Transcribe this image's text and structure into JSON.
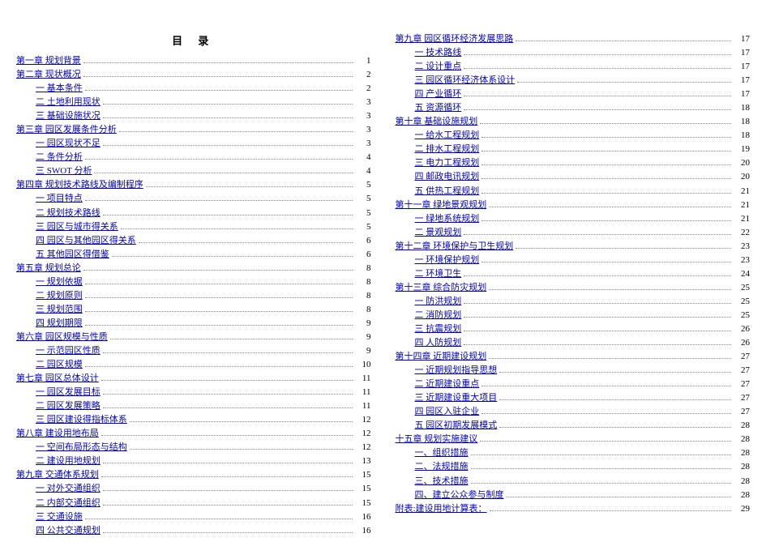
{
  "title": "目  录",
  "columns": [
    [
      {
        "label": "第一章 规划背景",
        "page": "1",
        "level": 0
      },
      {
        "label": "第二章 现状概况",
        "page": "2",
        "level": 0
      },
      {
        "label": "一 基本条件",
        "page": "2",
        "level": 1
      },
      {
        "label": "二 土地利用现状",
        "page": "3",
        "level": 1
      },
      {
        "label": "三 基础设施状况",
        "page": "3",
        "level": 1
      },
      {
        "label": "第三章 园区发展条件分析",
        "page": "3",
        "level": 0
      },
      {
        "label": "一 园区现状不足",
        "page": "3",
        "level": 1
      },
      {
        "label": "二 条件分析",
        "page": "4",
        "level": 1
      },
      {
        "label": "三 SWOT 分析",
        "page": "4",
        "level": 1
      },
      {
        "label": "第四章 规划技术路线及编制程序",
        "page": "5",
        "level": 0
      },
      {
        "label": "一 项目特点",
        "page": "5",
        "level": 1
      },
      {
        "label": "二 规划技术路线",
        "page": "5",
        "level": 1
      },
      {
        "label": "三 园区与城市得关系",
        "page": "5",
        "level": 1
      },
      {
        "label": "四 园区与其他园区得关系",
        "page": "6",
        "level": 1
      },
      {
        "label": "五 其他园区得借鉴",
        "page": "6",
        "level": 1
      },
      {
        "label": "第五章 规划总论",
        "page": "8",
        "level": 0
      },
      {
        "label": "一 规划依据",
        "page": "8",
        "level": 1
      },
      {
        "label": "二 规划原则",
        "page": "8",
        "level": 1
      },
      {
        "label": "三 规划范围",
        "page": "8",
        "level": 1
      },
      {
        "label": "四 规划期限",
        "page": "9",
        "level": 1
      },
      {
        "label": "第六章 园区规模与性质",
        "page": "9",
        "level": 0
      },
      {
        "label": "一 示范园区性质",
        "page": "9",
        "level": 1
      },
      {
        "label": "二 园区规模",
        "page": "10",
        "level": 1
      },
      {
        "label": "第七章 园区总体设计",
        "page": "11",
        "level": 0
      },
      {
        "label": "一 园区发展目标",
        "page": "11",
        "level": 1
      },
      {
        "label": "二 园区发展策略",
        "page": "11",
        "level": 1
      },
      {
        "label": "三 园区建设得指标体系",
        "page": "12",
        "level": 1
      },
      {
        "label": "第八章 建设用地布局",
        "page": "12",
        "level": 0
      },
      {
        "label": "一 空间布局形态与结构",
        "page": "12",
        "level": 1
      },
      {
        "label": "二 建设用地规划",
        "page": "13",
        "level": 1
      },
      {
        "label": "第九章 交通体系规划",
        "page": "15",
        "level": 0
      },
      {
        "label": "一 对外交通组织",
        "page": "15",
        "level": 1
      },
      {
        "label": "二 内部交通组织",
        "page": "15",
        "level": 1
      },
      {
        "label": "三 交通设施",
        "page": "16",
        "level": 1
      },
      {
        "label": "四 公共交通规划",
        "page": "16",
        "level": 1
      }
    ],
    [
      {
        "label": "第九章  园区循环经济发展思路",
        "page": "17",
        "level": 0
      },
      {
        "label": "一 技术路线",
        "page": "17",
        "level": 1
      },
      {
        "label": "二 设计重点",
        "page": "17",
        "level": 1
      },
      {
        "label": "三 园区循环经济体系设计",
        "page": "17",
        "level": 1
      },
      {
        "label": "四 产业循环",
        "page": "17",
        "level": 1
      },
      {
        "label": "五 资源循环",
        "page": "18",
        "level": 1
      },
      {
        "label": "第十章 基础设施规划",
        "page": "18",
        "level": 0
      },
      {
        "label": "一 给水工程规划",
        "page": "18",
        "level": 1
      },
      {
        "label": "二 排水工程规划",
        "page": "19",
        "level": 1
      },
      {
        "label": "三 电力工程规划",
        "page": "20",
        "level": 1
      },
      {
        "label": "四 邮政电讯规划",
        "page": "20",
        "level": 1
      },
      {
        "label": "五 供热工程规划",
        "page": "21",
        "level": 1
      },
      {
        "label": "第十一章 绿地景观规划",
        "page": "21",
        "level": 0
      },
      {
        "label": "一 绿地系统规划",
        "page": "21",
        "level": 1
      },
      {
        "label": "二 景观规划",
        "page": "22",
        "level": 1
      },
      {
        "label": "第十二章 环境保护与卫生规划",
        "page": "23",
        "level": 0
      },
      {
        "label": "一 环境保护规划",
        "page": "23",
        "level": 1
      },
      {
        "label": "二 环境卫生",
        "page": "24",
        "level": 1
      },
      {
        "label": "第十三章 综合防灾规划",
        "page": "25",
        "level": 0
      },
      {
        "label": "一 防洪规划",
        "page": "25",
        "level": 1
      },
      {
        "label": "二 消防规划",
        "page": "25",
        "level": 1
      },
      {
        "label": "三 抗震规划",
        "page": "26",
        "level": 1
      },
      {
        "label": "四 人防规划",
        "page": "26",
        "level": 1
      },
      {
        "label": "第十四章 近期建设规划",
        "page": "27",
        "level": 0
      },
      {
        "label": "一 近期规划指导思想",
        "page": "27",
        "level": 1
      },
      {
        "label": "二 近期建设重点",
        "page": "27",
        "level": 1
      },
      {
        "label": "三 近期建设重大项目",
        "page": "27",
        "level": 1
      },
      {
        "label": "四 园区入驻企业",
        "page": "27",
        "level": 1
      },
      {
        "label": "五 园区初期发展模式",
        "page": "28",
        "level": 1
      },
      {
        "label": "十五章 规划实施建议",
        "page": "28",
        "level": 0
      },
      {
        "label": "一、组织措施",
        "page": "28",
        "level": 1
      },
      {
        "label": "二、法规措施",
        "page": "28",
        "level": 1
      },
      {
        "label": "三、技术措施",
        "page": "28",
        "level": 1
      },
      {
        "label": "四、建立公众参与制度",
        "page": "28",
        "level": 1
      },
      {
        "label": "附表:建设用地计算表：",
        "page": "29",
        "level": 0
      }
    ]
  ]
}
